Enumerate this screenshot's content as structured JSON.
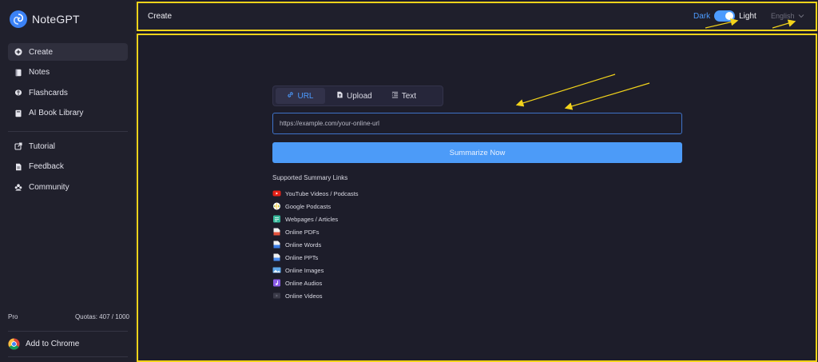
{
  "brand": {
    "name": "NoteGPT"
  },
  "sidebar": {
    "primary": [
      {
        "label": "Create",
        "icon": "plus-circle-icon",
        "active": true
      },
      {
        "label": "Notes",
        "icon": "notebook-icon"
      },
      {
        "label": "Flashcards",
        "icon": "brain-icon"
      },
      {
        "label": "AI Book Library",
        "icon": "book-icon"
      }
    ],
    "secondary": [
      {
        "label": "Tutorial",
        "icon": "external-link-icon"
      },
      {
        "label": "Feedback",
        "icon": "document-icon"
      },
      {
        "label": "Community",
        "icon": "community-icon"
      }
    ],
    "plan": "Pro",
    "quota": "Quotas: 407 / 1000",
    "chrome": "Add to Chrome"
  },
  "topbar": {
    "title": "Create",
    "theme_dark": "Dark",
    "theme_light": "Light",
    "theme_state": "light",
    "language": "English"
  },
  "main": {
    "tabs": [
      {
        "label": "URL",
        "icon": "link-icon",
        "active": true
      },
      {
        "label": "Upload",
        "icon": "upload-file-icon"
      },
      {
        "label": "Text",
        "icon": "text-lines-icon"
      }
    ],
    "url_placeholder": "https://example.com/your-online-url",
    "summarize_label": "Summarize Now",
    "supported_title": "Supported Summary Links",
    "supported": [
      {
        "label": "YouTube Videos / Podcasts",
        "icon": "youtube-icon",
        "color": "#e62117"
      },
      {
        "label": "Google Podcasts",
        "icon": "google-podcasts-icon",
        "color": "#fbbc04"
      },
      {
        "label": "Webpages / Articles",
        "icon": "webpage-icon",
        "color": "#35b89a"
      },
      {
        "label": "Online PDFs",
        "icon": "pdf-icon",
        "color": "#e5533d"
      },
      {
        "label": "Online Words",
        "icon": "word-icon",
        "color": "#3c7ee6"
      },
      {
        "label": "Online PPTs",
        "icon": "ppt-icon",
        "color": "#4c8ef0"
      },
      {
        "label": "Online Images",
        "icon": "image-icon",
        "color": "#5ea7e8"
      },
      {
        "label": "Online Audios",
        "icon": "audio-icon",
        "color": "#8a5ce8"
      },
      {
        "label": "Online Videos",
        "icon": "video-icon",
        "color": "#3a3a48"
      }
    ]
  },
  "colors": {
    "accent": "#4c9bff",
    "annotation": "#f2d31b"
  }
}
